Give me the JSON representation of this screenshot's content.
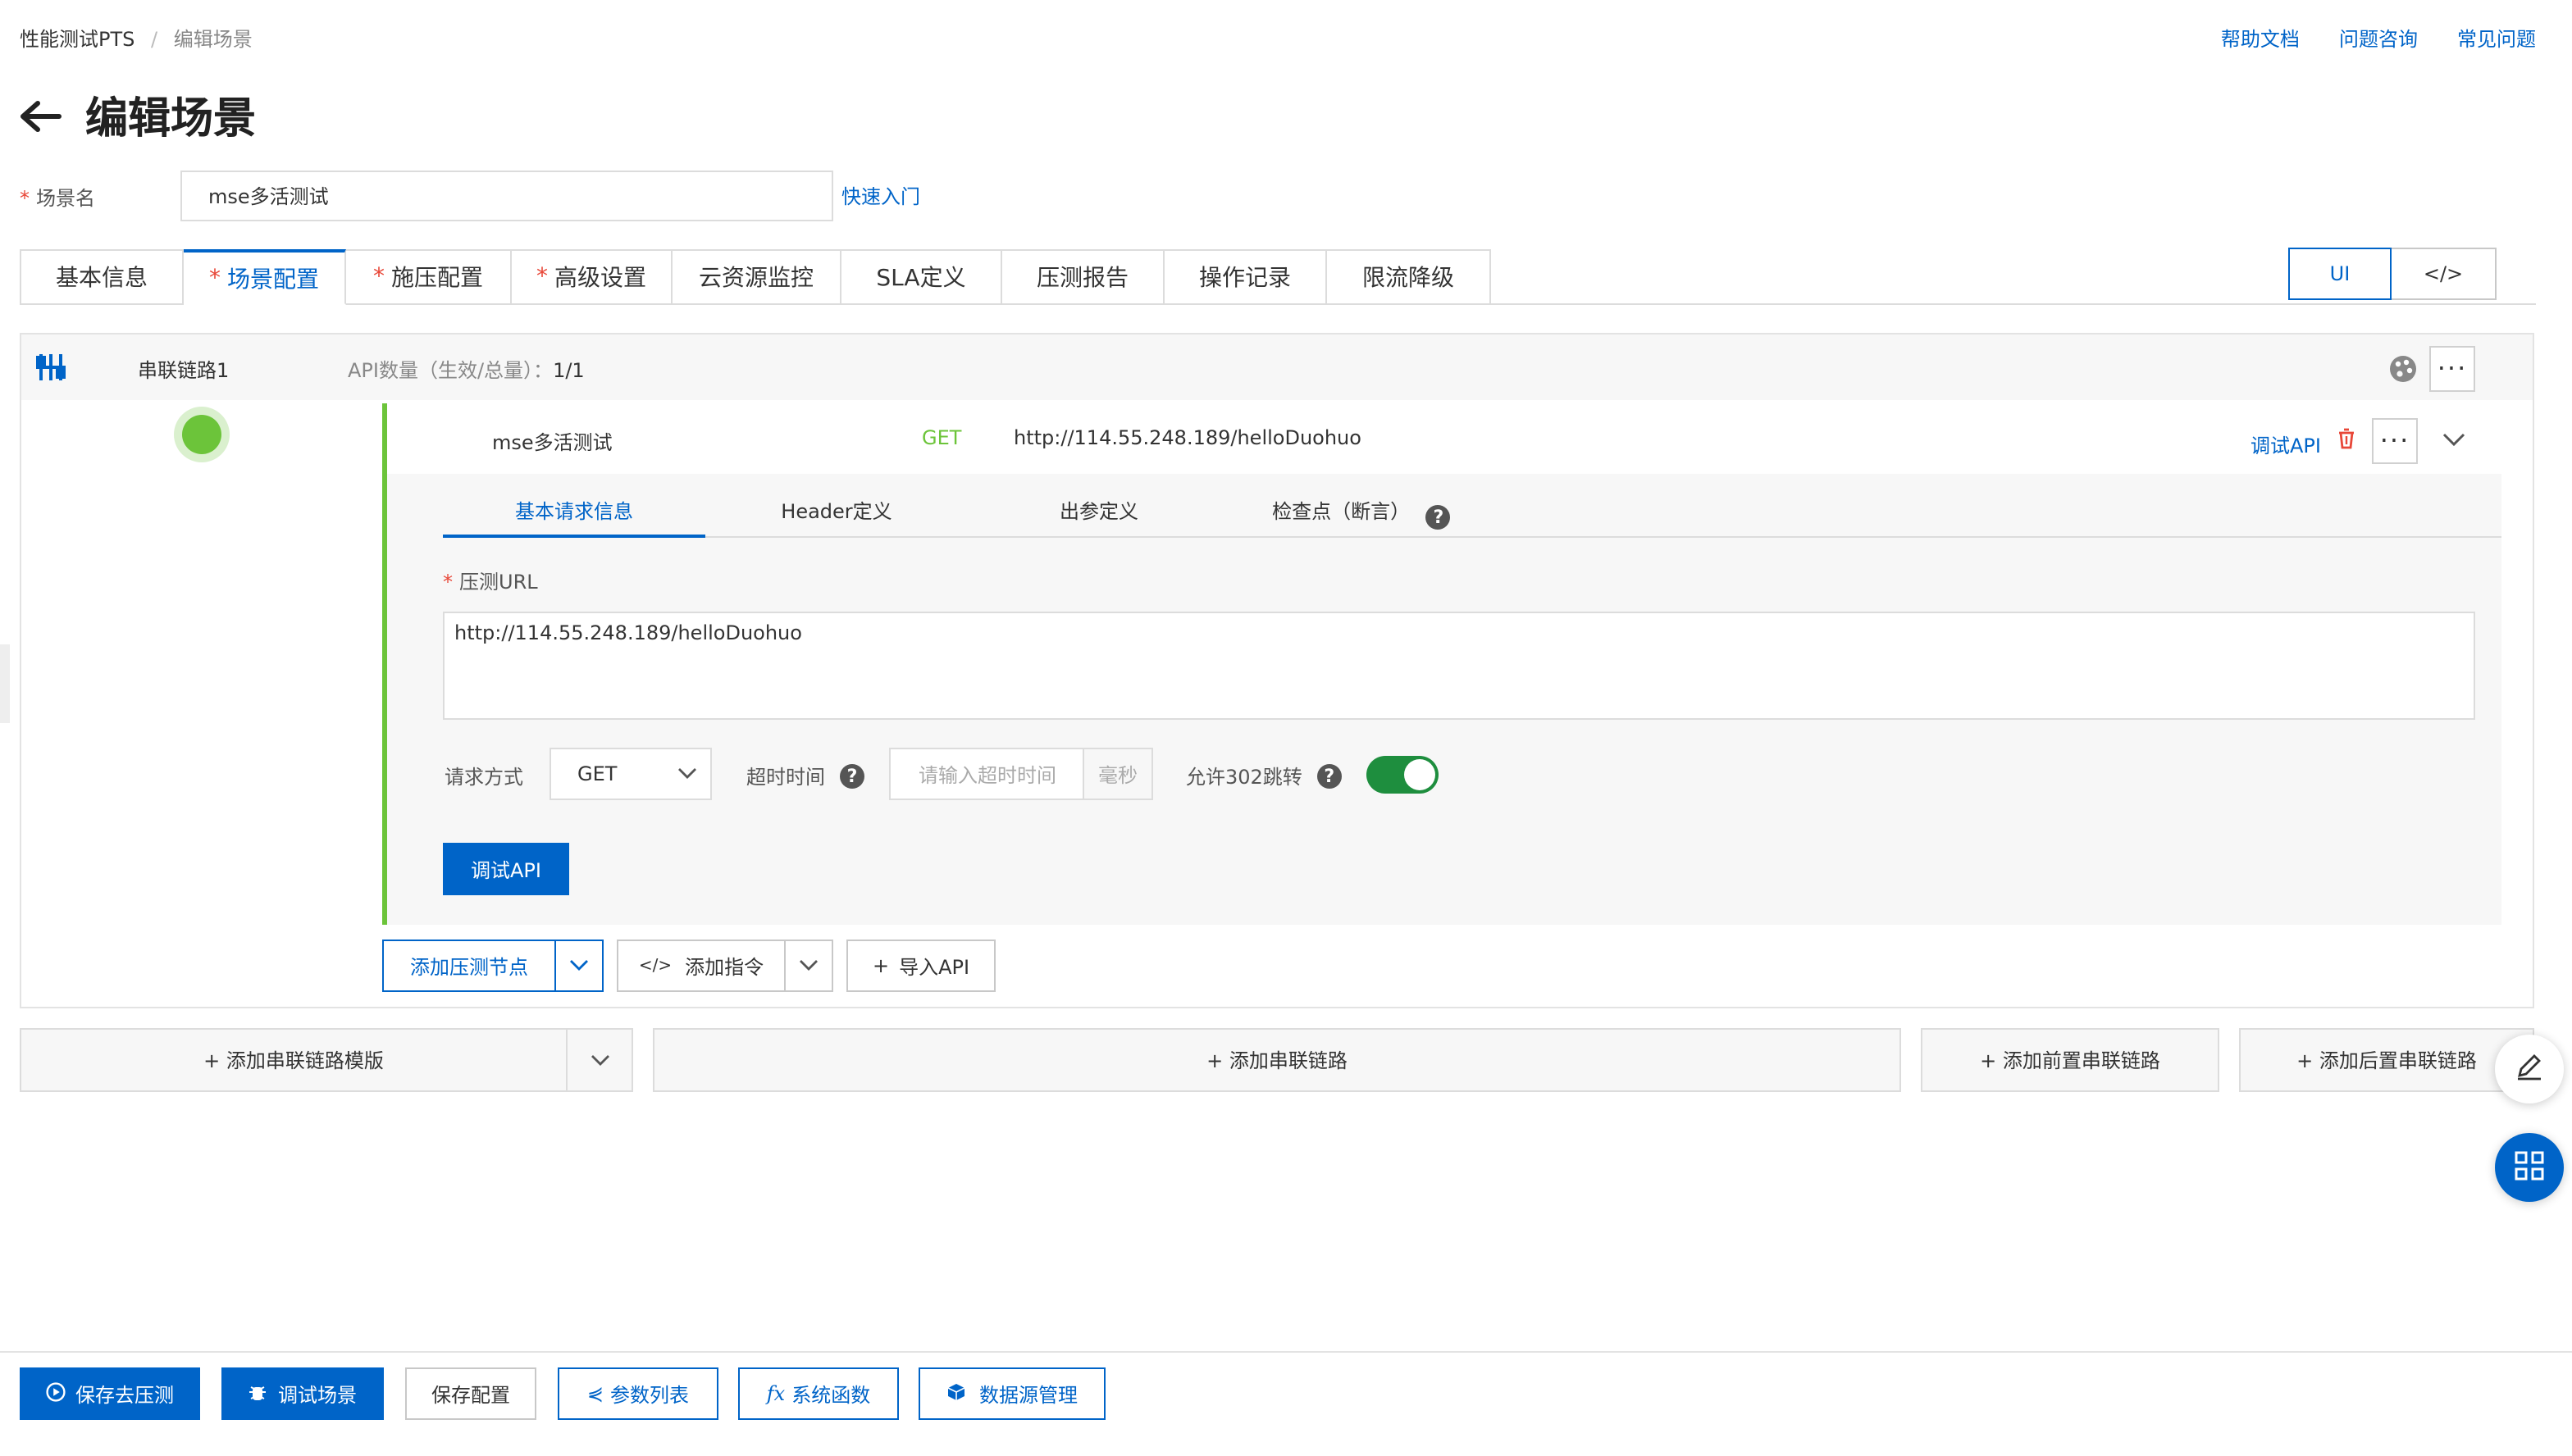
{
  "breadcrumb": {
    "root": "性能测试PTS",
    "sep": "/",
    "current": "编辑场景"
  },
  "top_links": {
    "help_docs": "帮助文档",
    "consult": "问题咨询",
    "faq": "常见问题"
  },
  "page_title": "编辑场景",
  "scene_name": {
    "label": "场景名",
    "value": "mse多活测试",
    "quick_start": "快速入门"
  },
  "tabs": [
    {
      "label": "基本信息",
      "required": false
    },
    {
      "label": "场景配置",
      "required": true
    },
    {
      "label": "施压配置",
      "required": true
    },
    {
      "label": "高级设置",
      "required": true
    },
    {
      "label": "云资源监控",
      "required": false
    },
    {
      "label": "SLA定义",
      "required": false
    },
    {
      "label": "压测报告",
      "required": false
    },
    {
      "label": "操作记录",
      "required": false
    },
    {
      "label": "限流降级",
      "required": false
    }
  ],
  "view_toggle": {
    "ui": "UI",
    "code": "</>"
  },
  "chain": {
    "name": "串联链路1",
    "api_count_label": "API数量（生效/总量）：",
    "api_count_value": "1/1"
  },
  "api": {
    "name": "mse多活测试",
    "method": "GET",
    "url": "http://114.55.248.189/helloDuohuo",
    "debug_link": "调试API"
  },
  "inner_tabs": [
    "基本请求信息",
    "Header定义",
    "出参定义",
    "检查点（断言）"
  ],
  "form": {
    "url_label": "压测URL",
    "url_value": "http://114.55.248.189/helloDuohuo",
    "method_label": "请求方式",
    "method_value": "GET",
    "timeout_label": "超时时间",
    "timeout_placeholder": "请输入超时时间",
    "timeout_unit": "毫秒",
    "redirect_label": "允许302跳转",
    "redirect_on": true,
    "debug_button": "调试API"
  },
  "node_actions": {
    "add_node": "添加压测节点",
    "add_cmd": "添加指令",
    "import_api": "导入API"
  },
  "chain_actions": {
    "add_template": "+ 添加串联链路模版",
    "add_chain": "+ 添加串联链路",
    "add_pre": "+ 添加前置串联链路",
    "add_post": "+ 添加后置串联链路"
  },
  "footer": {
    "save_run": "保存去压测",
    "debug_scene": "调试场景",
    "save_config": "保存配置",
    "params": "参数列表",
    "functions": "系统函数",
    "datasource": "数据源管理"
  },
  "colors": {
    "accent": "#0064c8",
    "green": "#6cc43a",
    "toggle_green": "#1e8e3e",
    "required": "#e84738"
  },
  "icons": [
    "back-arrow-icon",
    "chain-icon",
    "palette-icon",
    "more-icon",
    "trash-icon",
    "chevron-down-icon",
    "help-icon",
    "edit-icon",
    "apps-grid-icon"
  ]
}
